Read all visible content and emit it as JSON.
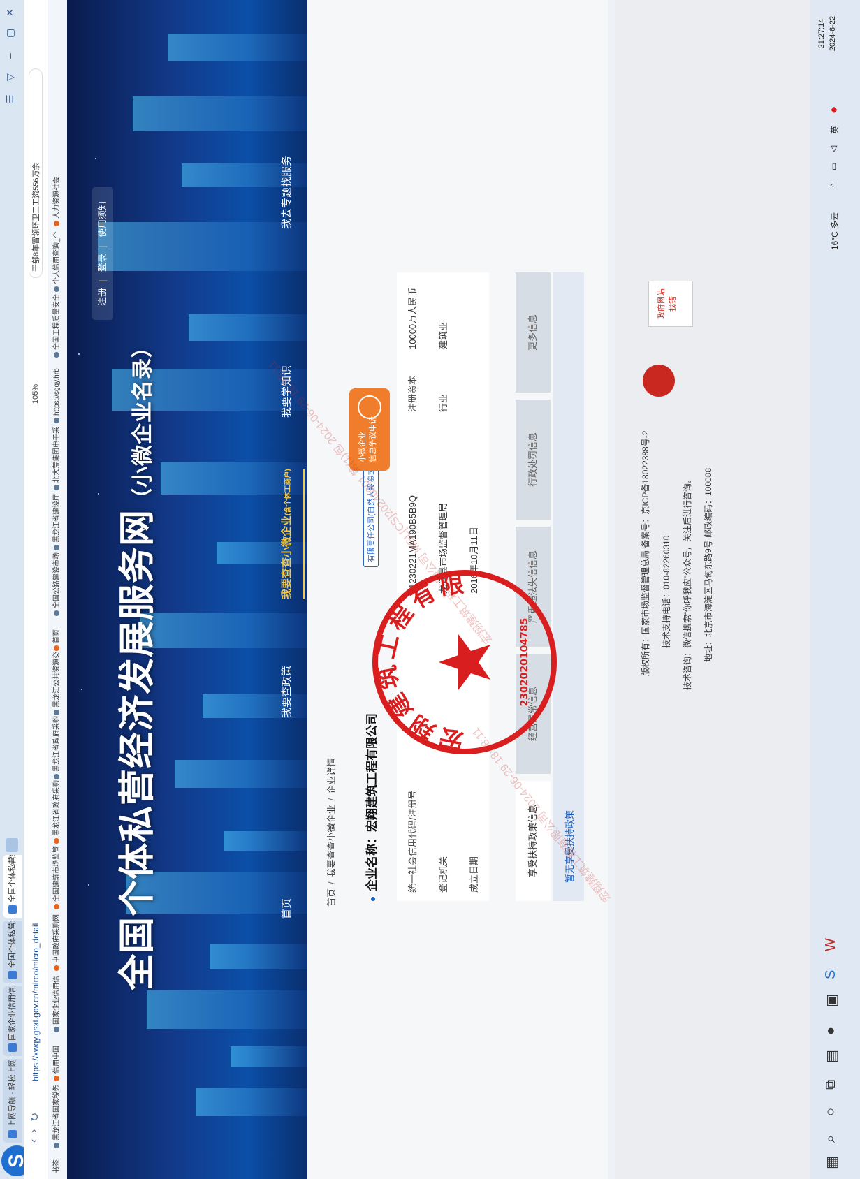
{
  "browser": {
    "tabs": [
      {
        "label": "上网导航 - 轻松上网 从这里开始"
      },
      {
        "label": "国家企业信用信息公示系统"
      },
      {
        "label": "全国个体私营经济发展服务网"
      },
      {
        "label": "全国个体私营经济发展服务网"
      }
    ],
    "url": "https://xwqy.gsxt.gov.cn/mirco/micro_detail",
    "zoom": "105%",
    "search_text": "干部8年冒领环卫工工资556万余",
    "bookmarks": [
      "书签",
      "黑龙江省国家税务",
      "信用中国",
      "国家企业信用信",
      "中国政府采购网",
      "全国建筑市场监管",
      "黑龙江省政府采购",
      "黑龙江省政府采购",
      "黑龙江公共资源交",
      "首页",
      "全国公路建设市场",
      "黑龙江省建设厅",
      "北大荒集团电子采",
      "https://sgqy.hrb",
      "全国工程质量安全",
      "个人信用查询_个",
      "人力资源社会"
    ]
  },
  "site": {
    "title": "全国个体私营经济发展服务网",
    "subtitle": "（小微企业名录）",
    "auth_links": [
      "注册",
      "登录",
      "使用须知"
    ],
    "nav": [
      {
        "label": "首页"
      },
      {
        "label": "我要查政策"
      },
      {
        "label": "我要查查小微企业",
        "badge": "(含个体工商户)"
      },
      {
        "label": "我要学知识"
      },
      {
        "label": "我去专题找服务"
      }
    ]
  },
  "breadcrumb": [
    "首页",
    "我要查查小微企业",
    "企业详情"
  ],
  "company": {
    "name_label": "企业名称：宏翔建筑工程有限公司",
    "type_badge": "有限责任公司(自然人投资或控股)",
    "dispute_button": "小微企业\n信息争议申诉",
    "fields": {
      "credit_code_label": "统一社会信用代码/注册号",
      "credit_code": "91230221MA190B5B9Q",
      "reg_capital_label": "注册资本",
      "reg_capital": "10000万人民币",
      "reg_authority_label": "登记机关",
      "reg_authority": "龙江县市场监督管理局",
      "industry_label": "行业",
      "industry": "建筑业",
      "founded_label": "成立日期",
      "founded": "2016年10月11日"
    },
    "tabs": [
      "享受扶持政策信息",
      "经营异常信息",
      "严重违法失信信息",
      "行政处罚信息",
      "更多信息"
    ],
    "policy_text": "暂无享受扶持政策"
  },
  "footer": {
    "line1": "版权所有：国家市场监督管理总局 备案号：京ICP备18022388号-2",
    "line2": "技术支持电话：010-82260310",
    "line3": "技术咨询：微信搜索“你呼我应”公众号，关注后进行咨询。",
    "line4": "地址：北京市海淀区马甸东路9号 邮政编码：100088",
    "gov_logo": "政府网站\n找错"
  },
  "seal": {
    "text": "宏翔建筑工程有限公司",
    "code": "2302020104785",
    "color": "#d81e1e"
  },
  "watermark": "宏翔建筑工程有限公司 2024-06-29 18:38:11",
  "watermark2": "宏翔建筑工程有限公司 MGL[CS]20240001 第(1)包 2024-06-29 18:38:11",
  "taskbar": {
    "weather": "16°C 多云",
    "input_method": "英",
    "time": "21:27:14",
    "date": "2024-6-22"
  }
}
